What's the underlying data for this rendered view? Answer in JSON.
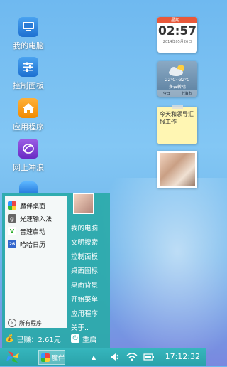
{
  "desktop": {
    "icons": [
      {
        "label": "我的电脑"
      },
      {
        "label": "控制面板"
      },
      {
        "label": "应用程序"
      },
      {
        "label": "网上冲浪"
      }
    ]
  },
  "widgets": {
    "clock": {
      "weekday": "星期二",
      "time": "02:57",
      "date": "2014年05月26日"
    },
    "weather": {
      "temp": "22°C~32°C",
      "condition": "多云转晴",
      "today": "今日",
      "city": "上海市"
    },
    "memo": {
      "text": "今天和领导汇报工作"
    }
  },
  "start_menu": {
    "apps": [
      {
        "label": "魔伴桌面",
        "icon": "pinwheel-icon",
        "color": "#e44"
      },
      {
        "label": "光速输入法",
        "icon": "g-icon",
        "color": "#555"
      },
      {
        "label": "音速启动",
        "icon": "v-icon",
        "color": "#2a2"
      },
      {
        "label": "哈哈日历",
        "icon": "calendar-icon",
        "color": "#36c"
      }
    ],
    "all_programs": "所有程序",
    "right_items": [
      "我的电脑",
      "文明搜索",
      "控制面板",
      "桌面图标",
      "桌面背景",
      "开始菜单",
      "应用程序",
      "关于.."
    ],
    "earnings": "已赚：2.61元",
    "restart": "重启"
  },
  "taskbar": {
    "task_label": "魔伴",
    "time": "17:12:32"
  }
}
